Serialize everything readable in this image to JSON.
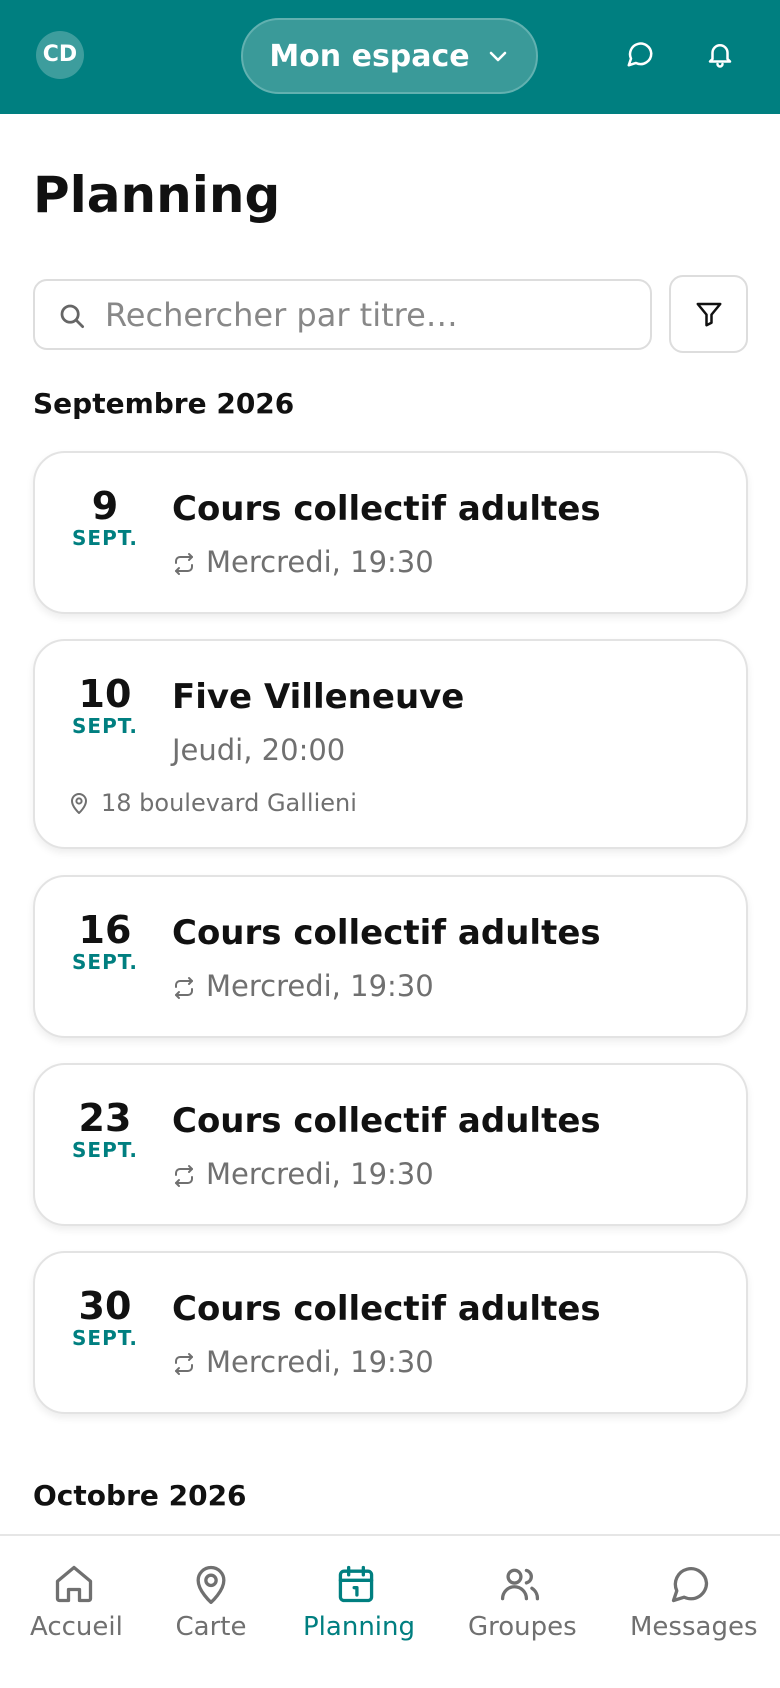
{
  "header": {
    "avatar_initials": "CD",
    "space_label": "Mon espace",
    "accent_color": "#007f80"
  },
  "page": {
    "title": "Planning"
  },
  "search": {
    "placeholder": "Rechercher par titre…",
    "value": ""
  },
  "sections": [
    {
      "month": "Septembre 2026",
      "events": [
        {
          "day": "9",
          "month": "SEPT.",
          "title": "Cours collectif adultes",
          "time": "Mercredi, 19:30",
          "recurring": true,
          "location": ""
        },
        {
          "day": "10",
          "month": "SEPT.",
          "title": "Five Villeneuve",
          "time": "Jeudi, 20:00",
          "recurring": false,
          "location": "18 boulevard Gallieni"
        },
        {
          "day": "16",
          "month": "SEPT.",
          "title": "Cours collectif adultes",
          "time": "Mercredi, 19:30",
          "recurring": true,
          "location": ""
        },
        {
          "day": "23",
          "month": "SEPT.",
          "title": "Cours collectif adultes",
          "time": "Mercredi, 19:30",
          "recurring": true,
          "location": ""
        },
        {
          "day": "30",
          "month": "SEPT.",
          "title": "Cours collectif adultes",
          "time": "Mercredi, 19:30",
          "recurring": true,
          "location": ""
        }
      ]
    },
    {
      "month": "Octobre 2026",
      "events": []
    }
  ],
  "bottom_nav": [
    {
      "label": "Accueil",
      "icon": "home-icon",
      "active": false
    },
    {
      "label": "Carte",
      "icon": "map-pin-icon",
      "active": false
    },
    {
      "label": "Planning",
      "icon": "calendar-icon",
      "active": true
    },
    {
      "label": "Groupes",
      "icon": "users-icon",
      "active": false
    },
    {
      "label": "Messages",
      "icon": "message-icon",
      "active": false
    }
  ]
}
